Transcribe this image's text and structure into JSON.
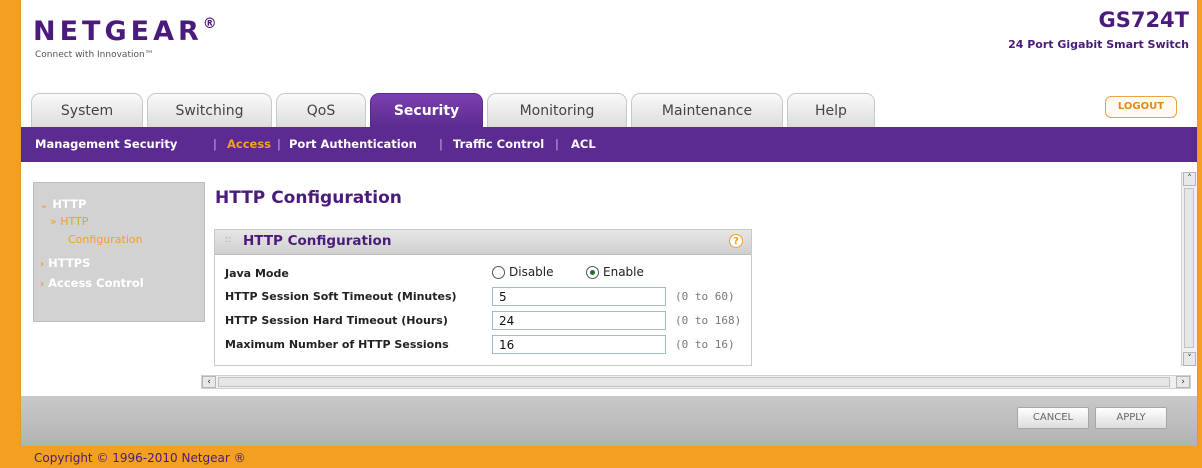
{
  "header": {
    "logo_text": "NETGEAR",
    "logo_mark": "®",
    "tagline": "Connect with Innovation™",
    "model": "GS724T",
    "model_desc": "24 Port Gigabit Smart Switch"
  },
  "tabs": [
    "System",
    "Switching",
    "QoS",
    "Security",
    "Monitoring",
    "Maintenance",
    "Help"
  ],
  "active_tab": "Security",
  "logout_label": "LOGOUT",
  "subnav": [
    "Management Security",
    "Access",
    "Port Authentication",
    "Traffic Control",
    "ACL"
  ],
  "subnav_active": "Access",
  "sidebar": {
    "http": "HTTP",
    "http_config_line1": "» HTTP",
    "http_config_line2": "Configuration",
    "https": "HTTPS",
    "access_control": "Access Control"
  },
  "page_title": "HTTP Configuration",
  "panel": {
    "title": "HTTP Configuration",
    "help": "?",
    "java_mode_label": "Java Mode",
    "disable_label": "Disable",
    "enable_label": "Enable",
    "java_mode_selected": "Enable",
    "soft_timeout_label": "HTTP Session Soft Timeout (Minutes)",
    "soft_timeout_value": "5",
    "soft_timeout_range": "(0 to 60)",
    "hard_timeout_label": "HTTP Session Hard Timeout (Hours)",
    "hard_timeout_value": "24",
    "hard_timeout_range": "(0 to 168)",
    "max_sessions_label": "Maximum Number of HTTP Sessions",
    "max_sessions_value": "16",
    "max_sessions_range": "(0 to 16)"
  },
  "buttons": {
    "cancel": "CANCEL",
    "apply": "APPLY"
  },
  "copyright": "Copyright © 1996-2010 Netgear ®",
  "colors": {
    "brand_purple": "#5b2b91",
    "accent_orange": "#f3a021"
  }
}
